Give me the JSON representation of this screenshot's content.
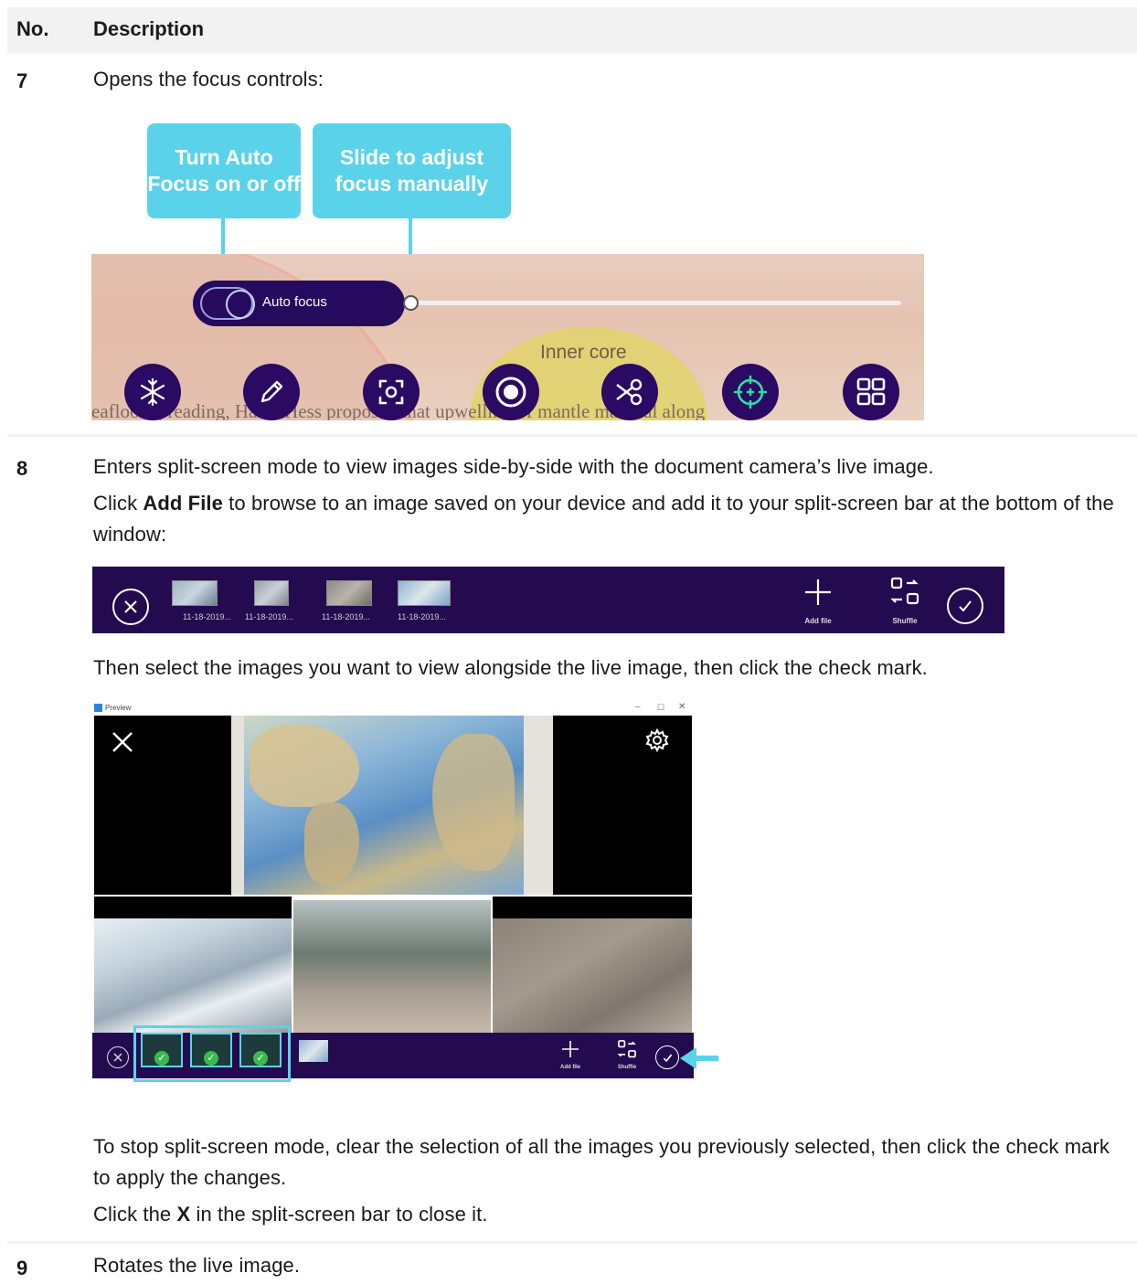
{
  "table": {
    "headers": {
      "no": "No.",
      "description": "Description"
    },
    "rows": {
      "r7": {
        "no": "7",
        "text": "Opens the focus controls:",
        "callout_autofocus": "Turn Auto Focus on or off",
        "callout_slide": "Slide to adjust focus manually",
        "autofocus_label": "Auto focus",
        "background_label": "Inner core",
        "background_text": "eafloor spreading, Harry Hess proposed that upwelling of mantle material along"
      },
      "r8": {
        "no": "8",
        "p1": "Enters split-screen mode to view images side-by-side with the document camera’s live image.",
        "p2_pre": "Click ",
        "p2_bold": "Add File",
        "p2_post": " to browse to an image saved on your device and add it to your split-screen bar at the bottom of the window:",
        "thumb_caption": "11-18-2019...",
        "add_file_label": "Add file",
        "shuffle_label": "Shuffle",
        "p3": "Then select the images you want to view alongside the live image, then click the check mark.",
        "preview_title": "Preview",
        "p4": "To stop split-screen mode, clear the selection of all the images you previously selected, then click the check mark to apply the changes.",
        "p5_pre": "Click the ",
        "p5_bold": "X",
        "p5_post": " in the split-screen bar to close it."
      },
      "r9": {
        "no": "9",
        "text": "Rotates the live image."
      }
    }
  },
  "icons": {
    "focus_controls": [
      "freeze-icon",
      "pen-icon",
      "capture-icon",
      "record-icon",
      "crop-icon",
      "focus-icon",
      "split-screen-icon"
    ],
    "split_bar": [
      "close-icon",
      "add-file-icon",
      "shuffle-icon",
      "check-icon"
    ]
  },
  "colors": {
    "callout": "#5ad3ea",
    "toolbar": "#240b4f",
    "control_button": "#2a0a63",
    "header_bg": "#f2f2f2",
    "selected_check": "#3db84f"
  }
}
